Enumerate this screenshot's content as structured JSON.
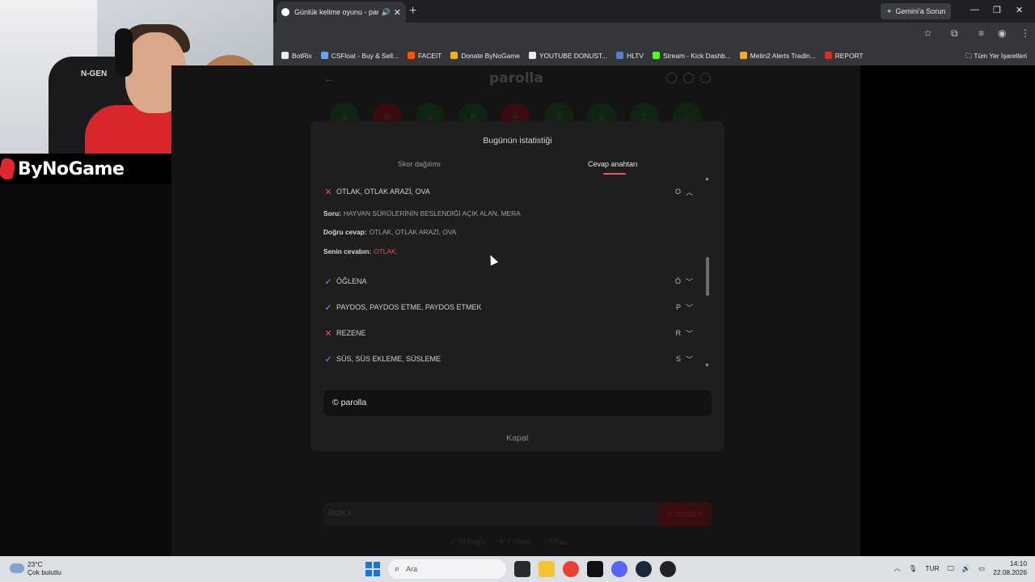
{
  "brand": {
    "name": "ByNoGame",
    "chair_logo": "N-GEN"
  },
  "browser": {
    "tab_title": "Günlük kelime oyunu - par",
    "gemini_label": "Gemini'a Sorun",
    "bookmarks": [
      "BotRix",
      "CSFloat - Buy & Sell...",
      "FACEIT",
      "Donate ByNoGame",
      "YOUTUBE DONUST...",
      "HLTV",
      "Stream - Kick Dashb...",
      "Metin2 Alerts Tradin...",
      "REPORT"
    ],
    "all_bookmarks": "Tüm Yer İşaretleri",
    "bookmark_colors": [
      "#e8eaed",
      "#6aa0ff",
      "#ff5500",
      "#f4b400",
      "#e8eaed",
      "#5b7fc8",
      "#53fc18",
      "#f5a623",
      "#d93025"
    ]
  },
  "game": {
    "logo": "parolla",
    "letters": [
      "N",
      "O",
      "O",
      "P",
      "R",
      "S",
      "Ş",
      "T",
      "U"
    ],
    "answer_placeholder": "ROKA",
    "pass_label": "⟳ DÖNDER",
    "stats": [
      "✓ 19 Doğru",
      "✕ 7 Yanlış",
      "» 0 Pas"
    ]
  },
  "modal": {
    "title": "Bugünün istatistiği",
    "tabs": [
      "Skor dağılımı",
      "Cevap anahtarı"
    ],
    "active_tab": 1,
    "expanded_item": {
      "word": "OTLAK, OTLAK ARAZİ, OVA",
      "letter": "O",
      "status": "wrong",
      "question_label": "Soru:",
      "question": "HAYVAN SÜRÜLERİNİN BESLENDİĞİ AÇIK ALAN, MERA",
      "correct_label": "Doğru cevap:",
      "correct": "OTLAK, OTLAK ARAZİ, OVA",
      "yours_label": "Senin cevabın:",
      "yours": "OTLAK,"
    },
    "items": [
      {
        "word": "ÖĞLENA",
        "letter": "Ö",
        "status": "right"
      },
      {
        "word": "PAYDOS, PAYDOS ETME, PAYDOS ETMEK",
        "letter": "P",
        "status": "right"
      },
      {
        "word": "REZENE",
        "letter": "R",
        "status": "wrong"
      },
      {
        "word": "SÜS, SÜS EKLEME, SÜSLEME",
        "letter": "S",
        "status": "right"
      }
    ],
    "footer": "© parolla",
    "close_label": "Kapat"
  },
  "taskbar": {
    "temperature": "23°C",
    "weather": "Çok bulutlu",
    "search_placeholder": "Ara",
    "language": "TUR",
    "time": "14:10",
    "date": "22.08.2026"
  }
}
